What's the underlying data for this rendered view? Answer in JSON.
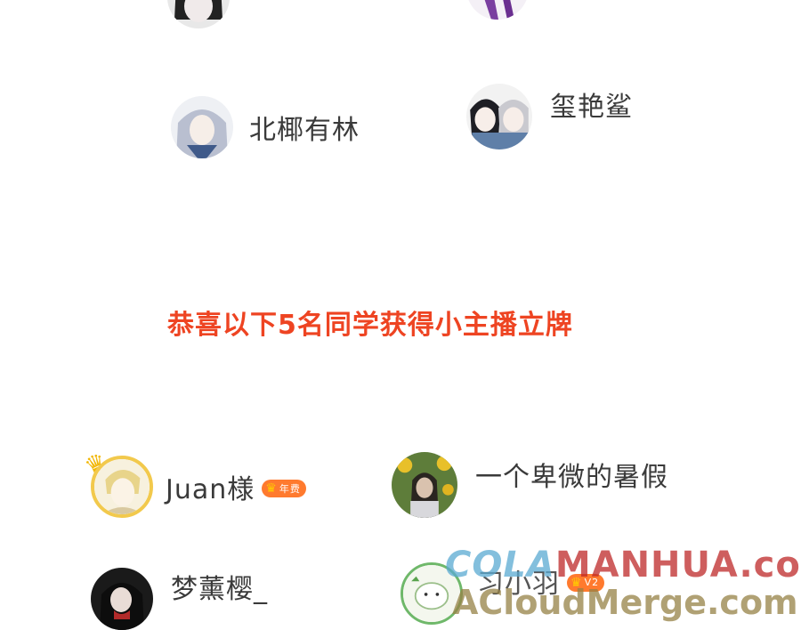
{
  "colors": {
    "announcement": "#ee4422",
    "username": "#3a3a3a",
    "badge": "#ff7a2e",
    "watermark_red": "#be2828",
    "watermark_blue": "#5aaad2",
    "watermark_gold": "#968246"
  },
  "top_users": [
    {
      "name": "北椰有林",
      "avatar_icon": "avatar-anime-silver-hair"
    },
    {
      "name": "玺艳鲨",
      "avatar_icon": "avatar-anime-two-boys"
    }
  ],
  "announcement": "恭喜以下5名同学获得小主播立牌",
  "winners": [
    {
      "name": "Juan様",
      "badge": "年费",
      "avatar_icon": "avatar-blonde-man"
    },
    {
      "name": "一个卑微的暑假",
      "avatar_icon": "avatar-sunflower-girl"
    },
    {
      "name": "梦薰樱_",
      "avatar_icon": "avatar-dark-girl"
    },
    {
      "name": "习小羽",
      "badge": "V2",
      "avatar_icon": "avatar-sheep"
    }
  ],
  "watermark": {
    "line1_prefix": "COLA",
    "line1_rest": "MANHUA.com",
    "line2": "ACloudMerge.com"
  }
}
